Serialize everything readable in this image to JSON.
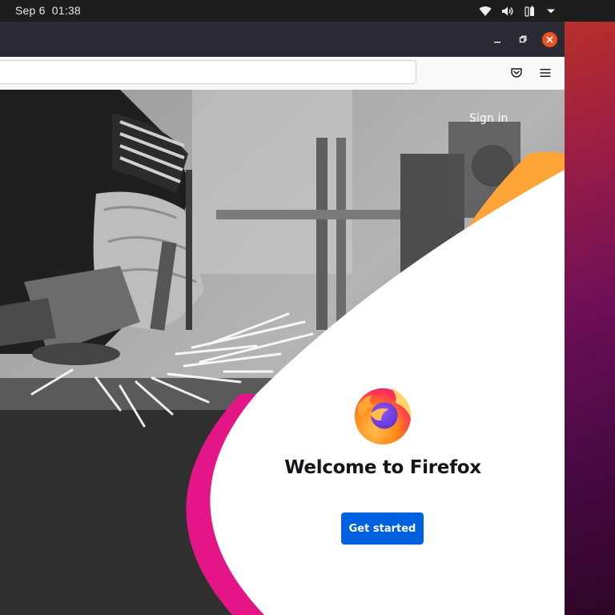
{
  "system": {
    "date": "Sep 6",
    "time": "01:38",
    "tray_icons": [
      "wifi-icon",
      "volume-icon",
      "battery-icon",
      "dropdown-arrow-icon"
    ]
  },
  "browser": {
    "url": "",
    "toolbar_icons": [
      "pocket-icon",
      "hamburger-menu-icon"
    ],
    "window_controls": [
      "minimize",
      "maximize",
      "close"
    ],
    "close_color": "#e95420"
  },
  "page": {
    "sign_in": "Sign in",
    "headline": "Welcome to Firefox",
    "cta": "Get started",
    "cta_color": "#0061e0",
    "accent_pink": "#e31587",
    "accent_orange": "#ffa436"
  }
}
